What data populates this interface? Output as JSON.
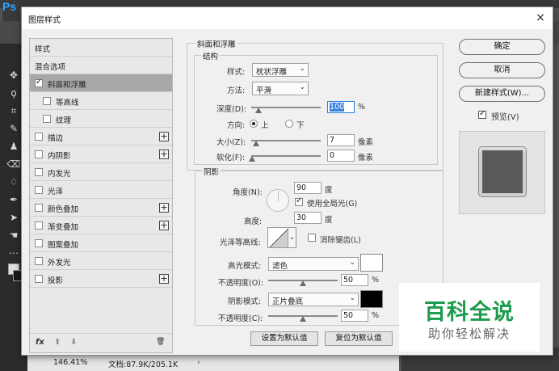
{
  "app": {
    "logo": "Ps"
  },
  "status_bar": {
    "zoom": "146.41%",
    "doc_info": "文档:87.9K/205.1K"
  },
  "dialog": {
    "title": "图层样式",
    "close_symbol": "×"
  },
  "left_panel": {
    "header": "样式",
    "blend_options": "混合选项",
    "items": [
      {
        "label": "斜面和浮雕",
        "checked": true,
        "selected": true,
        "has_plus": false
      },
      {
        "label": "等高线",
        "checked": false,
        "sub": true
      },
      {
        "label": "纹理",
        "checked": false,
        "sub": true
      },
      {
        "label": "描边",
        "checked": false,
        "has_plus": true
      },
      {
        "label": "内阴影",
        "checked": false,
        "has_plus": true
      },
      {
        "label": "内发光",
        "checked": false,
        "has_plus": false
      },
      {
        "label": "光泽",
        "checked": false,
        "has_plus": false
      },
      {
        "label": "颜色叠加",
        "checked": false,
        "has_plus": true
      },
      {
        "label": "渐变叠加",
        "checked": false,
        "has_plus": true
      },
      {
        "label": "图案叠加",
        "checked": false,
        "has_plus": false
      },
      {
        "label": "外发光",
        "checked": false,
        "has_plus": false
      },
      {
        "label": "投影",
        "checked": false,
        "has_plus": true
      }
    ],
    "footer": {
      "fx": "fx",
      "up": "⬆",
      "down": "⬇",
      "trash": "🗑"
    }
  },
  "bevel": {
    "section_title": "斜面和浮雕",
    "structure_title": "结构",
    "style_label": "样式:",
    "style_value": "枕状浮雕",
    "method_label": "方法:",
    "method_value": "平滑",
    "depth_label": "深度(D):",
    "depth_value": "100",
    "depth_unit": "%",
    "depth_fraction": 0.1,
    "direction_label": "方向:",
    "direction_up": "上",
    "direction_down": "下",
    "size_label": "大小(Z):",
    "size_value": "7",
    "size_unit": "像素",
    "soften_label": "软化(F):",
    "soften_value": "0",
    "soften_unit": "像素"
  },
  "shading": {
    "title": "阴影",
    "angle_label": "角度(N):",
    "angle_value": "90",
    "angle_unit": "度",
    "global_light_label": "使用全局光(G)",
    "global_light_checked": true,
    "altitude_label": "高度:",
    "altitude_value": "30",
    "altitude_unit": "度",
    "gloss_contour_label": "光泽等高线:",
    "antialias_label": "消除锯齿(L)",
    "highlight_mode_label": "高光模式:",
    "highlight_mode_value": "滤色",
    "highlight_color": "#ffffff",
    "highlight_opacity_label": "不透明度(O):",
    "highlight_opacity_value": "50",
    "highlight_opacity_unit": "%",
    "shadow_mode_label": "阴影模式:",
    "shadow_mode_value": "正片叠底",
    "shadow_color": "#000000",
    "shadow_opacity_label": "不透明度(C):",
    "shadow_opacity_value": "50",
    "shadow_opacity_unit": "%"
  },
  "bottom_buttons": {
    "set_default": "设置为默认值",
    "reset_default": "复位为默认值"
  },
  "right_buttons": {
    "ok": "确定",
    "cancel": "取消",
    "new_style": "新建样式(W)...",
    "preview_label": "预览(V)",
    "preview_checked": true
  },
  "watermark": {
    "title": "百科全说",
    "subtitle": "助你轻松解决"
  },
  "icons": [
    "close-icon",
    "plus-icon",
    "fx-icon",
    "arrow-up-icon",
    "arrow-down-icon",
    "trash-icon",
    "dropdown-arrow-icon"
  ]
}
